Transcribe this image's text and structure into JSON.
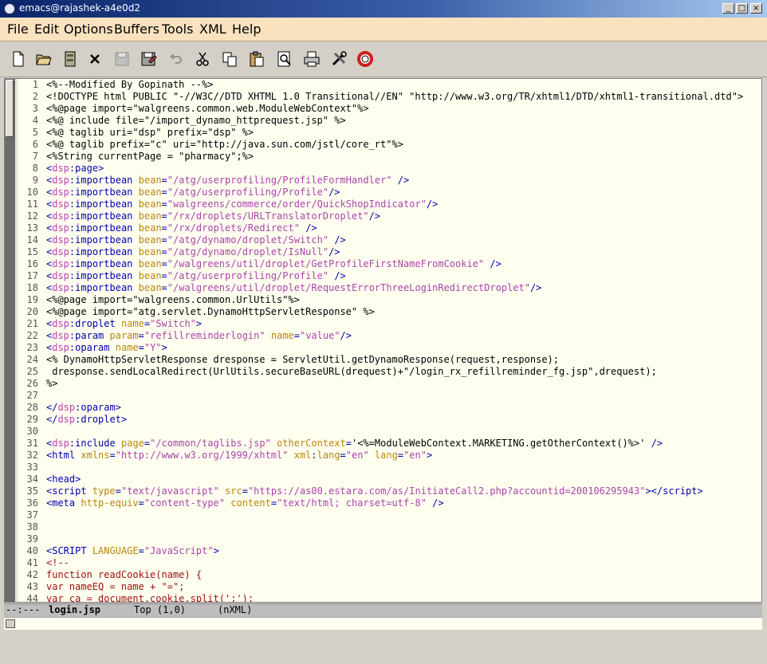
{
  "window": {
    "title": "emacs@rajashek-a4e0d2"
  },
  "menubar": [
    "File",
    "Edit",
    "Options",
    "Buffers",
    "Tools",
    "XML",
    "Help"
  ],
  "toolbar": [
    "new-file",
    "open-file",
    "open-directory",
    "close-buffer",
    "save",
    "save-as",
    "undo",
    "cut",
    "copy",
    "paste",
    "search",
    "print",
    "preferences",
    "help"
  ],
  "editor": {
    "lines": [
      {
        "n": "1",
        "segs": [
          [
            "p",
            "<%--Modified By Gopinath --%>"
          ]
        ]
      },
      {
        "n": "2",
        "segs": [
          [
            "p",
            "<!DOCTYPE html PUBLIC \"-//W3C//DTD XHTML 1.0 Transitional//EN\" \"http://www.w3.org/TR/xhtml1/DTD/xhtml1-transitional.dtd\">"
          ]
        ]
      },
      {
        "n": "3",
        "segs": [
          [
            "p",
            "<%@page import=\"walgreens.common.web.ModuleWebContext\"%>"
          ]
        ]
      },
      {
        "n": "4",
        "segs": [
          [
            "p",
            "<%@ include file=\"/import_dynamo_httprequest.jsp\" %>"
          ]
        ]
      },
      {
        "n": "5",
        "segs": [
          [
            "p",
            "<%@ taglib uri=\"dsp\" prefix=\"dsp\" %>"
          ]
        ]
      },
      {
        "n": "6",
        "segs": [
          [
            "p",
            "<%@ taglib prefix=\"c\" uri=\"http://java.sun.com/jstl/core_rt\"%>"
          ]
        ]
      },
      {
        "n": "7",
        "segs": [
          [
            "p",
            "<%String currentPage = \"pharmacy\";%>"
          ]
        ]
      },
      {
        "n": "8",
        "segs": [
          [
            "d",
            "<"
          ],
          [
            "n",
            "dsp"
          ],
          [
            "d",
            ":"
          ],
          [
            "t",
            "page"
          ],
          [
            "d",
            ">"
          ]
        ]
      },
      {
        "n": "9",
        "segs": [
          [
            "d",
            "<"
          ],
          [
            "n",
            "dsp"
          ],
          [
            "d",
            ":"
          ],
          [
            "t",
            "importbean"
          ],
          [
            "p",
            " "
          ],
          [
            "a",
            "bean"
          ],
          [
            "d",
            "="
          ],
          [
            "v",
            "\"/atg/userprofiling/ProfileFormHandler\""
          ],
          [
            "p",
            " "
          ],
          [
            "d",
            "/>"
          ]
        ]
      },
      {
        "n": "10",
        "segs": [
          [
            "d",
            "<"
          ],
          [
            "n",
            "dsp"
          ],
          [
            "d",
            ":"
          ],
          [
            "t",
            "importbean"
          ],
          [
            "p",
            " "
          ],
          [
            "a",
            "bean"
          ],
          [
            "d",
            "="
          ],
          [
            "v",
            "\"/atg/userprofiling/Profile\""
          ],
          [
            "d",
            "/>"
          ]
        ]
      },
      {
        "n": "11",
        "segs": [
          [
            "d",
            "<"
          ],
          [
            "n",
            "dsp"
          ],
          [
            "d",
            ":"
          ],
          [
            "t",
            "importbean"
          ],
          [
            "p",
            " "
          ],
          [
            "a",
            "bean"
          ],
          [
            "d",
            "="
          ],
          [
            "v",
            "\"walgreens/commerce/order/QuickShopIndicator\""
          ],
          [
            "d",
            "/>"
          ]
        ]
      },
      {
        "n": "12",
        "segs": [
          [
            "d",
            "<"
          ],
          [
            "n",
            "dsp"
          ],
          [
            "d",
            ":"
          ],
          [
            "t",
            "importbean"
          ],
          [
            "p",
            " "
          ],
          [
            "a",
            "bean"
          ],
          [
            "d",
            "="
          ],
          [
            "v",
            "\"/rx/droplets/URLTranslatorDroplet\""
          ],
          [
            "d",
            "/>"
          ]
        ]
      },
      {
        "n": "13",
        "segs": [
          [
            "d",
            "<"
          ],
          [
            "n",
            "dsp"
          ],
          [
            "d",
            ":"
          ],
          [
            "t",
            "importbean"
          ],
          [
            "p",
            " "
          ],
          [
            "a",
            "bean"
          ],
          [
            "d",
            "="
          ],
          [
            "v",
            "\"/rx/droplets/Redirect\""
          ],
          [
            "p",
            " "
          ],
          [
            "d",
            "/>"
          ]
        ]
      },
      {
        "n": "14",
        "segs": [
          [
            "d",
            "<"
          ],
          [
            "n",
            "dsp"
          ],
          [
            "d",
            ":"
          ],
          [
            "t",
            "importbean"
          ],
          [
            "p",
            " "
          ],
          [
            "a",
            "bean"
          ],
          [
            "d",
            "="
          ],
          [
            "v",
            "\"/atg/dynamo/droplet/Switch\""
          ],
          [
            "p",
            " "
          ],
          [
            "d",
            "/>"
          ]
        ]
      },
      {
        "n": "15",
        "segs": [
          [
            "d",
            "<"
          ],
          [
            "n",
            "dsp"
          ],
          [
            "d",
            ":"
          ],
          [
            "t",
            "importbean"
          ],
          [
            "p",
            " "
          ],
          [
            "a",
            "bean"
          ],
          [
            "d",
            "="
          ],
          [
            "v",
            "\"/atg/dynamo/droplet/IsNull\""
          ],
          [
            "d",
            "/>"
          ]
        ]
      },
      {
        "n": "16",
        "segs": [
          [
            "d",
            "<"
          ],
          [
            "n",
            "dsp"
          ],
          [
            "d",
            ":"
          ],
          [
            "t",
            "importbean"
          ],
          [
            "p",
            " "
          ],
          [
            "a",
            "bean"
          ],
          [
            "d",
            "="
          ],
          [
            "v",
            "\"/walgreens/util/droplet/GetProfileFirstNameFromCookie\""
          ],
          [
            "p",
            " "
          ],
          [
            "d",
            "/>"
          ]
        ]
      },
      {
        "n": "17",
        "segs": [
          [
            "d",
            "<"
          ],
          [
            "n",
            "dsp"
          ],
          [
            "d",
            ":"
          ],
          [
            "t",
            "importbean"
          ],
          [
            "p",
            " "
          ],
          [
            "a",
            "bean"
          ],
          [
            "d",
            "="
          ],
          [
            "v",
            "\"/atg/userprofiling/Profile\""
          ],
          [
            "p",
            " "
          ],
          [
            "d",
            "/>"
          ]
        ]
      },
      {
        "n": "18",
        "segs": [
          [
            "d",
            "<"
          ],
          [
            "n",
            "dsp"
          ],
          [
            "d",
            ":"
          ],
          [
            "t",
            "importbean"
          ],
          [
            "p",
            " "
          ],
          [
            "a",
            "bean"
          ],
          [
            "d",
            "="
          ],
          [
            "v",
            "\"/walgreens/util/droplet/RequestErrorThreeLoginRedirectDroplet\""
          ],
          [
            "d",
            "/>"
          ]
        ]
      },
      {
        "n": "19",
        "segs": [
          [
            "p",
            "<%@page import=\"walgreens.common.UrlUtils\"%>"
          ]
        ]
      },
      {
        "n": "20",
        "segs": [
          [
            "p",
            "<%@page import=\"atg.servlet.DynamoHttpServletResponse\" %>"
          ]
        ]
      },
      {
        "n": "21",
        "segs": [
          [
            "d",
            "<"
          ],
          [
            "n",
            "dsp"
          ],
          [
            "d",
            ":"
          ],
          [
            "t",
            "droplet"
          ],
          [
            "p",
            " "
          ],
          [
            "a",
            "name"
          ],
          [
            "d",
            "="
          ],
          [
            "v",
            "\"Switch\""
          ],
          [
            "d",
            ">"
          ]
        ]
      },
      {
        "n": "22",
        "segs": [
          [
            "d",
            "<"
          ],
          [
            "n",
            "dsp"
          ],
          [
            "d",
            ":"
          ],
          [
            "t",
            "param"
          ],
          [
            "p",
            " "
          ],
          [
            "a",
            "param"
          ],
          [
            "d",
            "="
          ],
          [
            "v",
            "\"refillreminderlogin\""
          ],
          [
            "p",
            " "
          ],
          [
            "a",
            "name"
          ],
          [
            "d",
            "="
          ],
          [
            "v",
            "\"value\""
          ],
          [
            "d",
            "/>"
          ]
        ]
      },
      {
        "n": "23",
        "segs": [
          [
            "d",
            "<"
          ],
          [
            "n",
            "dsp"
          ],
          [
            "d",
            ":"
          ],
          [
            "t",
            "oparam"
          ],
          [
            "p",
            " "
          ],
          [
            "a",
            "name"
          ],
          [
            "d",
            "="
          ],
          [
            "v",
            "\"Y\""
          ],
          [
            "d",
            ">"
          ]
        ]
      },
      {
        "n": "24",
        "segs": [
          [
            "p",
            "<% DynamoHttpServletResponse dresponse = ServletUtil.getDynamoResponse(request,response);"
          ]
        ]
      },
      {
        "n": "25",
        "segs": [
          [
            "p",
            " dresponse.sendLocalRedirect(UrlUtils.secureBaseURL(drequest)+\"/login_rx_refillreminder_fg.jsp\",drequest);"
          ]
        ]
      },
      {
        "n": "26",
        "segs": [
          [
            "p",
            "%>"
          ]
        ]
      },
      {
        "n": "27",
        "segs": []
      },
      {
        "n": "28",
        "segs": [
          [
            "d",
            "</"
          ],
          [
            "n",
            "dsp"
          ],
          [
            "d",
            ":"
          ],
          [
            "t",
            "oparam"
          ],
          [
            "d",
            ">"
          ]
        ]
      },
      {
        "n": "29",
        "segs": [
          [
            "d",
            "</"
          ],
          [
            "n",
            "dsp"
          ],
          [
            "d",
            ":"
          ],
          [
            "t",
            "droplet"
          ],
          [
            "d",
            ">"
          ]
        ]
      },
      {
        "n": "30",
        "segs": []
      },
      {
        "n": "31",
        "segs": [
          [
            "d",
            "<"
          ],
          [
            "n",
            "dsp"
          ],
          [
            "d",
            ":"
          ],
          [
            "t",
            "include"
          ],
          [
            "p",
            " "
          ],
          [
            "a",
            "page"
          ],
          [
            "d",
            "="
          ],
          [
            "v",
            "\"/common/taglibs.jsp\""
          ],
          [
            "p",
            " "
          ],
          [
            "a",
            "otherContext"
          ],
          [
            "d",
            "="
          ],
          [
            "p",
            "'<%=ModuleWebContext.MARKETING.getOtherContext()%>'"
          ],
          [
            "p",
            " "
          ],
          [
            "d",
            "/>"
          ]
        ]
      },
      {
        "n": "32",
        "segs": [
          [
            "d",
            "<"
          ],
          [
            "t",
            "html"
          ],
          [
            "p",
            " "
          ],
          [
            "a",
            "xmlns"
          ],
          [
            "d",
            "="
          ],
          [
            "v",
            "\"http://www.w3.org/1999/xhtml\""
          ],
          [
            "p",
            " "
          ],
          [
            "a",
            "xml"
          ],
          [
            "d",
            ":"
          ],
          [
            "a",
            "lang"
          ],
          [
            "d",
            "="
          ],
          [
            "v",
            "\"en\""
          ],
          [
            "p",
            " "
          ],
          [
            "a",
            "lang"
          ],
          [
            "d",
            "="
          ],
          [
            "v",
            "\"en\""
          ],
          [
            "d",
            ">"
          ]
        ]
      },
      {
        "n": "33",
        "segs": []
      },
      {
        "n": "34",
        "segs": [
          [
            "d",
            "<"
          ],
          [
            "t",
            "head"
          ],
          [
            "d",
            ">"
          ]
        ]
      },
      {
        "n": "35",
        "segs": [
          [
            "d",
            "<"
          ],
          [
            "t",
            "script"
          ],
          [
            "p",
            " "
          ],
          [
            "a",
            "type"
          ],
          [
            "d",
            "="
          ],
          [
            "v",
            "\"text/javascript\""
          ],
          [
            "p",
            " "
          ],
          [
            "a",
            "src"
          ],
          [
            "d",
            "="
          ],
          [
            "v",
            "\"https://as00.estara.com/as/InitiateCall2.php?accountid=200106295943\""
          ],
          [
            "d",
            "></"
          ],
          [
            "t",
            "script"
          ],
          [
            "d",
            ">"
          ]
        ]
      },
      {
        "n": "36",
        "segs": [
          [
            "d",
            "<"
          ],
          [
            "t",
            "meta"
          ],
          [
            "p",
            " "
          ],
          [
            "a",
            "http-equiv"
          ],
          [
            "d",
            "="
          ],
          [
            "v",
            "\"content-type\""
          ],
          [
            "p",
            " "
          ],
          [
            "a",
            "content"
          ],
          [
            "d",
            "="
          ],
          [
            "v",
            "\"text/html; charset=utf-8\""
          ],
          [
            "p",
            " "
          ],
          [
            "d",
            "/>"
          ]
        ]
      },
      {
        "n": "37",
        "segs": []
      },
      {
        "n": "38",
        "segs": []
      },
      {
        "n": "39",
        "segs": []
      },
      {
        "n": "40",
        "segs": [
          [
            "d",
            "<"
          ],
          [
            "t",
            "SCRIPT"
          ],
          [
            "p",
            " "
          ],
          [
            "a",
            "LANGUAGE"
          ],
          [
            "d",
            "="
          ],
          [
            "v",
            "\"JavaScript\""
          ],
          [
            "d",
            ">"
          ]
        ]
      },
      {
        "n": "41",
        "segs": [
          [
            "r",
            "<!--"
          ]
        ]
      },
      {
        "n": "42",
        "segs": [
          [
            "r",
            "function readCookie(name) {"
          ]
        ]
      },
      {
        "n": "43",
        "segs": [
          [
            "r",
            "var nameEQ = name + \"=\";"
          ]
        ]
      },
      {
        "n": "44",
        "segs": [
          [
            "r",
            "var ca = document.cookie.split(';');"
          ]
        ]
      }
    ]
  },
  "modeline": {
    "flags": "--:---",
    "buffer": "login.jsp",
    "position": "Top (1,0)",
    "mode": "(nXML)"
  }
}
